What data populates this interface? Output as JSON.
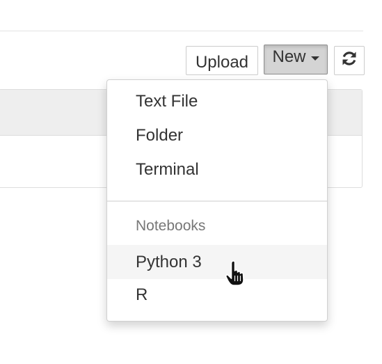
{
  "toolbar": {
    "upload_label": "Upload",
    "new_label": "New",
    "refresh_icon": "refresh-icon"
  },
  "new_menu": {
    "items": [
      {
        "label": "Text File"
      },
      {
        "label": "Folder"
      },
      {
        "label": "Terminal"
      }
    ],
    "section_header": "Notebooks",
    "notebook_items": [
      {
        "label": "Python 3",
        "highlighted": true
      },
      {
        "label": "R",
        "highlighted": false
      }
    ]
  },
  "pointer": "hand-pointer-icon"
}
